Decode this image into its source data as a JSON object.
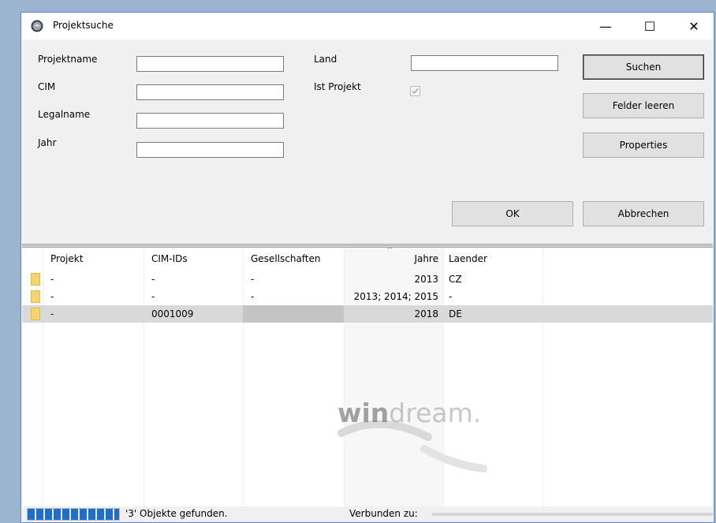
{
  "window": {
    "title": "Projektsuche",
    "minimize_glyph": "—",
    "maximize_glyph": "☐",
    "close_glyph": "✕"
  },
  "form": {
    "projektname_label": "Projektname",
    "projektname_value": "",
    "cim_label": "CIM",
    "cim_value": "",
    "legalname_label": "Legalname",
    "legalname_value": "",
    "jahr_label": "Jahr",
    "jahr_value": "",
    "land_label": "Land",
    "land_value": "",
    "ist_projekt_label": "Ist Projekt",
    "ist_projekt_checked": true
  },
  "buttons": {
    "suchen": "Suchen",
    "felder_leeren": "Felder leeren",
    "properties": "Properties",
    "ok": "OK",
    "abbrechen": "Abbrechen"
  },
  "table": {
    "columns": [
      "Projekt",
      "CIM-IDs",
      "Gesellschaften",
      "Jahre",
      "Laender"
    ],
    "sorted_column": "Jahre",
    "rows": [
      {
        "projekt": "-",
        "cim_ids": "-",
        "gesellschaften": "-",
        "jahre": "2013",
        "laender": "CZ",
        "icon": "folder-icon"
      },
      {
        "projekt": "-",
        "cim_ids": "-",
        "gesellschaften": "-",
        "jahre": "2013; 2014; 2015",
        "laender": "-",
        "icon": "folder-icon"
      },
      {
        "projekt": "-",
        "cim_ids": "0001009",
        "gesellschaften": "",
        "jahre": "2018",
        "laender": "DE",
        "icon": "folder-icon",
        "selected": true
      }
    ]
  },
  "watermark": {
    "bold": "win",
    "rest": "dream."
  },
  "status": {
    "progress_percent": 100,
    "found_text": "'3' Objekte gefunden.",
    "connected_label": "Verbunden zu:"
  },
  "colors": {
    "progress": "#1f6fc8",
    "window_border": "#5a88c4",
    "folder": "#f5d36e"
  }
}
